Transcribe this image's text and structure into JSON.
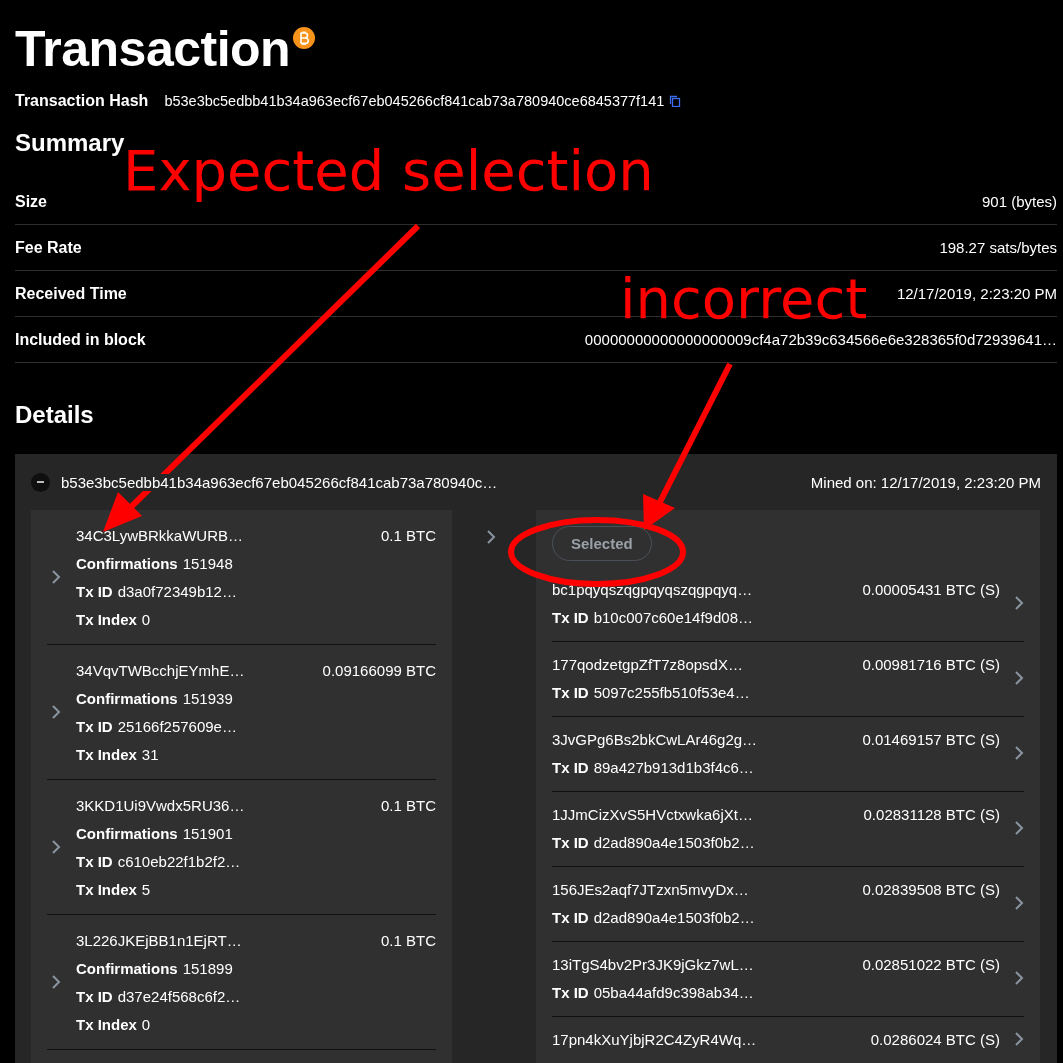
{
  "title": "Transaction",
  "hash": {
    "label": "Transaction Hash",
    "value": "b53e3bc5edbb41b34a963ecf67eb045266cf841cab73a780940ce6845377f141"
  },
  "summary": {
    "heading": "Summary",
    "rows": [
      {
        "label": "Size",
        "value": "901 (bytes)"
      },
      {
        "label": "Fee Rate",
        "value": "198.27 sats/bytes"
      },
      {
        "label": "Received Time",
        "value": "12/17/2019, 2:23:20 PM"
      },
      {
        "label": "Included in block",
        "value": "00000000000000000009cf4a72b39c634566e6e328365f0d72939641…"
      }
    ]
  },
  "details": {
    "heading": "Details",
    "tx": {
      "expanded": true,
      "hash": "b53e3bc5edbb41b34a963ecf67eb045266cf841cab73a780940c…",
      "mined": "Mined on: 12/17/2019, 2:23:20 PM"
    },
    "inputs": [
      {
        "address": "34C3LywBRkkaWURB…",
        "amount": "0.1 BTC",
        "fields": [
          {
            "label": "Confirmations",
            "value": "151948"
          },
          {
            "label": "Tx ID",
            "value": "d3a0f72349b12…"
          },
          {
            "label": "Tx Index",
            "value": "0"
          }
        ]
      },
      {
        "address": "34VqvTWBcchjEYmhE…",
        "amount": "0.09166099 BTC",
        "fields": [
          {
            "label": "Confirmations",
            "value": "151939"
          },
          {
            "label": "Tx ID",
            "value": "25166f257609e…"
          },
          {
            "label": "Tx Index",
            "value": "31"
          }
        ]
      },
      {
        "address": "3KKD1Ui9Vwdx5RU36…",
        "amount": "0.1 BTC",
        "fields": [
          {
            "label": "Confirmations",
            "value": "151901"
          },
          {
            "label": "Tx ID",
            "value": "c610eb22f1b2f2…"
          },
          {
            "label": "Tx Index",
            "value": "5"
          }
        ]
      },
      {
        "address": "3L226JKEjBB1n1EjRT…",
        "amount": "0.1 BTC",
        "fields": [
          {
            "label": "Confirmations",
            "value": "151899"
          },
          {
            "label": "Tx ID",
            "value": "d37e24f568c6f2…"
          },
          {
            "label": "Tx Index",
            "value": "0"
          }
        ]
      }
    ],
    "chip": "Selected",
    "outputs": [
      {
        "address": "bc1pqyqszqgpqyqszqgpqyq…",
        "amount": "0.00005431 BTC (S)",
        "fields": [
          {
            "label": "Tx ID",
            "value": "b10c007c60e14f9d08…"
          }
        ]
      },
      {
        "address": "177qodzetgpZfT7z8opsdX…",
        "amount": "0.00981716 BTC (S)",
        "fields": [
          {
            "label": "Tx ID",
            "value": "5097c255fb510f53e4…"
          }
        ]
      },
      {
        "address": "3JvGPg6Bs2bkCwLAr46g2g…",
        "amount": "0.01469157 BTC (S)",
        "fields": [
          {
            "label": "Tx ID",
            "value": "89a427b913d1b3f4c6…"
          }
        ]
      },
      {
        "address": "1JJmCizXvS5HVctxwka6jXt…",
        "amount": "0.02831128 BTC (S)",
        "fields": [
          {
            "label": "Tx ID",
            "value": "d2ad890a4e1503f0b2…"
          }
        ]
      },
      {
        "address": "156JEs2aqf7JTzxn5mvyDx…",
        "amount": "0.02839508 BTC (S)",
        "fields": [
          {
            "label": "Tx ID",
            "value": "d2ad890a4e1503f0b2…"
          }
        ]
      },
      {
        "address": "13iTgS4bv2Pr3JK9jGkz7wL…",
        "amount": "0.02851022 BTC (S)",
        "fields": [
          {
            "label": "Tx ID",
            "value": "05ba44afd9c398ab34…"
          }
        ]
      },
      {
        "address": "17pn4kXuYjbjR2C4ZyR4Wq…",
        "amount": "0.0286024 BTC (S)"
      }
    ]
  },
  "annotations": [
    {
      "kind": "label",
      "text": "Expected selection"
    },
    {
      "kind": "label",
      "text": "incorrect"
    }
  ]
}
